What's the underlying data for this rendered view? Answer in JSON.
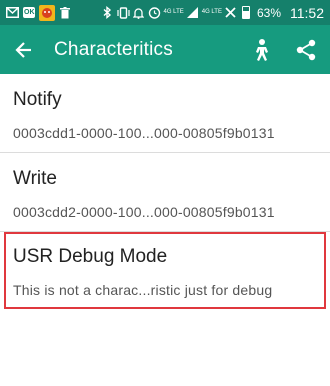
{
  "status_bar": {
    "battery_percent": "63%",
    "time": "11:52",
    "network_top": "4G LTE",
    "network_bottom": "4G LTE"
  },
  "app_bar": {
    "title": "Characteritics",
    "icons": [
      "back-arrow-icon",
      "run-icon",
      "share-icon"
    ]
  },
  "characteristics": [
    {
      "name": "Notify",
      "uuid": "0003cdd1-0000-100...000-00805f9b0131"
    },
    {
      "name": "Write",
      "uuid": "0003cdd2-0000-100...000-00805f9b0131"
    },
    {
      "name": "USR Debug Mode",
      "uuid": "This is not a charac...ristic just for debug"
    }
  ],
  "colors": {
    "status_bar": "#15806b",
    "app_bar": "#169b7f",
    "highlight_border": "#e0383e"
  }
}
